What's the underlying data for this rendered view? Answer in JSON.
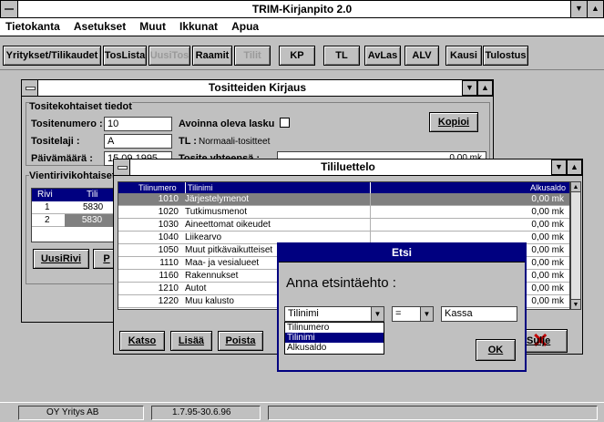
{
  "app": {
    "title": "TRIM-Kirjanpito 2.0",
    "menu": [
      "Tietokanta",
      "Asetukset",
      "Muut",
      "Ikkunat",
      "Apua"
    ],
    "toolbar": [
      {
        "label": "Yritykset/Tilikaudet",
        "enabled": true
      },
      {
        "label": "TosLista",
        "enabled": true
      },
      {
        "label": "UusiTos",
        "enabled": false
      },
      {
        "label": "Raamit",
        "enabled": true
      },
      {
        "label": "Tilit",
        "enabled": false
      },
      {
        "label": "KP",
        "enabled": true
      },
      {
        "label": "TL",
        "enabled": true
      },
      {
        "label": "AvLas",
        "enabled": true
      },
      {
        "label": "ALV",
        "enabled": true
      },
      {
        "label": "Kausi",
        "enabled": true
      },
      {
        "label": "Tulostus",
        "enabled": true
      }
    ],
    "status": {
      "company": "OY Yritys AB",
      "period": "1.7.95-30.6.96"
    }
  },
  "kirjaus": {
    "title": "Tositteiden Kirjaus",
    "section1": "Tositekohtaiset tiedot",
    "tositenumero_label": "Tositenumero :",
    "tositenumero": "10",
    "tositelaji_label": "Tositelaji :",
    "tositelaji": "A",
    "paivamaara_label": "Päivämäärä :",
    "paivamaara": "15.09.1995",
    "avoinna_label": "Avoinna oleva lasku",
    "tl_label": "TL :",
    "tl_value": "Normaali-tositteet",
    "tosite_yht_label": "Tosite yhteensä :",
    "tosite_yht_value": "0,00 mk",
    "kopioi": "Kopioi",
    "section2": "Vientirivikohtaiset",
    "grid_headers": [
      "Rivi",
      "Tili"
    ],
    "grid_rows": [
      {
        "rivi": "1",
        "tili": "5830"
      },
      {
        "rivi": "2",
        "tili": "5830"
      }
    ],
    "uusirivi": "UusiRivi",
    "p_btn": "P"
  },
  "tililuettelo": {
    "title": "Tililuettelo",
    "headers": [
      "Tilinumero",
      "Tilinimi",
      "Alkusaldo"
    ],
    "rows": [
      {
        "num": "1010",
        "name": "Järjestelymenot",
        "saldo": "0,00 mk"
      },
      {
        "num": "1020",
        "name": "Tutkimusmenot",
        "saldo": "0,00 mk"
      },
      {
        "num": "1030",
        "name": "Aineettomat oikeudet",
        "saldo": "0,00 mk"
      },
      {
        "num": "1040",
        "name": "Liikearvo",
        "saldo": "0,00 mk"
      },
      {
        "num": "1050",
        "name": "Muut pitkävaikutteiset",
        "saldo": "0,00 mk"
      },
      {
        "num": "1110",
        "name": "Maa- ja vesialueet",
        "saldo": "0,00 mk"
      },
      {
        "num": "1160",
        "name": "Rakennukset",
        "saldo": "0,00 mk"
      },
      {
        "num": "1210",
        "name": "Autot",
        "saldo": "0,00 mk"
      },
      {
        "num": "1220",
        "name": "Muu kalusto",
        "saldo": "0,00 mk"
      }
    ],
    "buttons": [
      "Katso",
      "Lisää",
      "Poista"
    ],
    "sulje": "Sulje"
  },
  "etsi": {
    "title": "Etsi",
    "prompt": "Anna etsintäehto :",
    "field_value": "Tilinimi",
    "field_options": [
      "Tilinumero",
      "Tilinimi",
      "Alkusaldo"
    ],
    "operator": "=",
    "search_value": "Kassa",
    "ok": "OK"
  }
}
